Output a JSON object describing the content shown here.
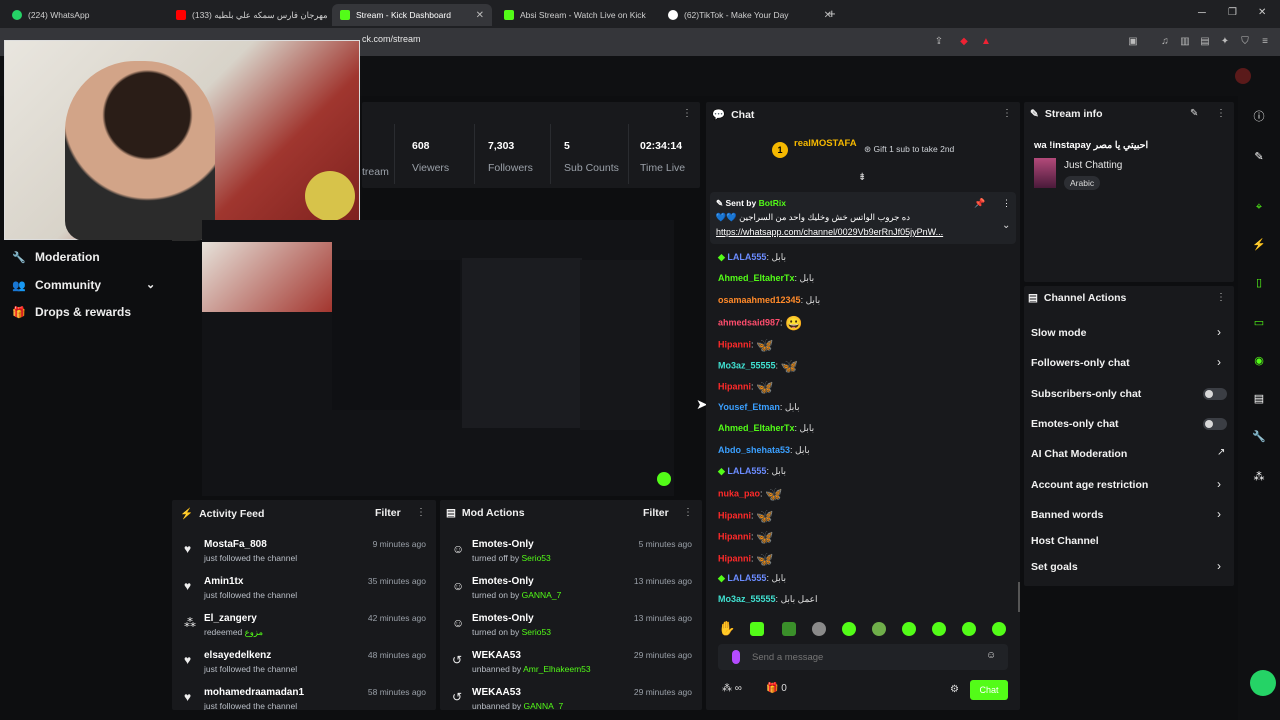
{
  "browser": {
    "tabs": [
      {
        "label": "(224) WhatsApp",
        "color": "#25d366"
      },
      {
        "label": "مهرجان فارس سمكه علي بلطيه (133)",
        "color": "#ff0000"
      },
      {
        "label": "Stream - Kick Dashboard",
        "color": "#53fc18"
      },
      {
        "label": "Absi Stream - Watch Live on Kick",
        "color": "#53fc18"
      },
      {
        "label": "(62)TikTok - Make Your Day",
        "color": "#ffffff"
      }
    ],
    "tab_close": "✕",
    "new_tab": "+",
    "url": "ck.com/stream"
  },
  "stats": {
    "stream_partial": "tream",
    "items": [
      {
        "value": "608",
        "label": "Viewers"
      },
      {
        "value": "7,303",
        "label": "Followers"
      },
      {
        "value": "5",
        "label": "Sub Counts"
      },
      {
        "value": "02:34:14",
        "label": "Time Live"
      }
    ]
  },
  "sidebar": {
    "items": [
      {
        "label": "Moderation",
        "icon": "wrench-icon"
      },
      {
        "label": "Community",
        "icon": "users-icon"
      },
      {
        "label": "Drops & rewards",
        "icon": "gift-icon"
      }
    ]
  },
  "activity_feed": {
    "title": "Activity Feed",
    "filter": "Filter",
    "rows": [
      {
        "name": "MostaFa_808",
        "sub": "just followed the channel",
        "time": "9 minutes ago",
        "icon": "heart"
      },
      {
        "name": "Amin1tx",
        "sub": "just followed the channel",
        "time": "35 minutes ago",
        "icon": "heart"
      },
      {
        "name": "El_zangery",
        "sub": "redeemed",
        "sub_highlight": "مزوع",
        "time": "42 minutes ago",
        "icon": "points"
      },
      {
        "name": "elsayedelkenz",
        "sub": "just followed the channel",
        "time": "48 minutes ago",
        "icon": "heart"
      },
      {
        "name": "mohamedraamadan1",
        "sub": "just followed the channel",
        "time": "58 minutes ago",
        "icon": "heart"
      }
    ]
  },
  "mod_actions": {
    "title": "Mod Actions",
    "filter": "Filter",
    "rows": [
      {
        "name": "Emotes-Only",
        "sub": "turned off by",
        "who": "Serio53",
        "time": "5 minutes ago"
      },
      {
        "name": "Emotes-Only",
        "sub": "turned on by",
        "who": "GANNA_7",
        "time": "13 minutes ago"
      },
      {
        "name": "Emotes-Only",
        "sub": "turned on by",
        "who": "Serio53",
        "time": "13 minutes ago"
      },
      {
        "name": "WEKAA53",
        "sub": "unbanned by",
        "who": "Amr_Elhakeem53",
        "time": "29 minutes ago"
      },
      {
        "name": "WEKAA53",
        "sub": "unbanned by",
        "who": "GANNA_7",
        "time": "29 minutes ago"
      }
    ]
  },
  "chat": {
    "title": "Chat",
    "top_gifter": "realMOSTAFA",
    "top_gifter_count": "1",
    "gift_hint": "Gift 1 sub to take 2nd",
    "pinned": {
      "sent_by": "Sent by",
      "bot": "BotRix",
      "text": "ده جروب الواتس خش وخليك واحد من السراجين 💙💙",
      "link": "https://whatsapp.com/channel/0029Vb9erRnJf05jyPnW..."
    },
    "messages": [
      {
        "user": "LALA555",
        "color": "#6b8cff",
        "text": "بابل",
        "badge": true
      },
      {
        "user": "Ahmed_EltaherTx",
        "color": "#53fc18",
        "text": "بابل"
      },
      {
        "user": "osamaahmed12345",
        "color": "#ff8a2a",
        "text": "بابل"
      },
      {
        "user": "ahmedsaid987",
        "color": "#ff4d6d",
        "text": "",
        "emote": "😀"
      },
      {
        "user": "Hipanni",
        "color": "#ff2a2a",
        "text": "",
        "emote": "🦋"
      },
      {
        "user": "Mo3az_55555",
        "color": "#40e0d0",
        "text": "",
        "emote": "🦋"
      },
      {
        "user": "Hipanni",
        "color": "#ff2a2a",
        "text": "",
        "emote": "🦋"
      },
      {
        "user": "Yousef_Etman",
        "color": "#3ba0ff",
        "text": "بابل"
      },
      {
        "user": "Ahmed_EltaherTx",
        "color": "#53fc18",
        "text": "بابل"
      },
      {
        "user": "Abdo_shehata53",
        "color": "#3ba0ff",
        "text": "بابل"
      },
      {
        "user": "LALA555",
        "color": "#6b8cff",
        "text": "بابل",
        "badge": true
      },
      {
        "user": "nuka_pao",
        "color": "#ff2a2a",
        "text": "",
        "emote": "🦋"
      },
      {
        "user": "Hipanni",
        "color": "#ff2a2a",
        "text": "",
        "emote": "🦋"
      },
      {
        "user": "Hipanni",
        "color": "#ff2a2a",
        "text": "",
        "emote": "🦋"
      },
      {
        "user": "Hipanni",
        "color": "#ff2a2a",
        "text": "",
        "emote": "🦋"
      },
      {
        "user": "LALA555",
        "color": "#6b8cff",
        "text": "بابل",
        "badge": true
      },
      {
        "user": "Mo3az_55555",
        "color": "#40e0d0",
        "text": "اعمل بابل"
      }
    ],
    "placeholder": "Send a message",
    "chat_button": "Chat",
    "viewers_count": "0",
    "infinity": "∞"
  },
  "stream_info": {
    "title": "Stream info",
    "stream_title": "wa !instapay احبيتي يا مصر",
    "category": "Just Chatting",
    "language": "Arabic"
  },
  "channel_actions": {
    "title": "Channel Actions",
    "items": [
      {
        "label": "Slow mode",
        "control": "chevron"
      },
      {
        "label": "Followers-only chat",
        "control": "chevron"
      },
      {
        "label": "Subscribers-only chat",
        "control": "toggle",
        "on": false
      },
      {
        "label": "Emotes-only chat",
        "control": "toggle",
        "on": false
      },
      {
        "label": "AI Chat Moderation",
        "control": "external"
      },
      {
        "label": "Account age restriction",
        "control": "chevron"
      },
      {
        "label": "Banned words",
        "control": "chevron"
      },
      {
        "label": "Host Channel",
        "control": "none"
      },
      {
        "label": "Set goals",
        "control": "chevron"
      }
    ]
  },
  "colors": {
    "accent": "#53fc18",
    "panel": "#18191c",
    "background": "#0d0e10"
  }
}
